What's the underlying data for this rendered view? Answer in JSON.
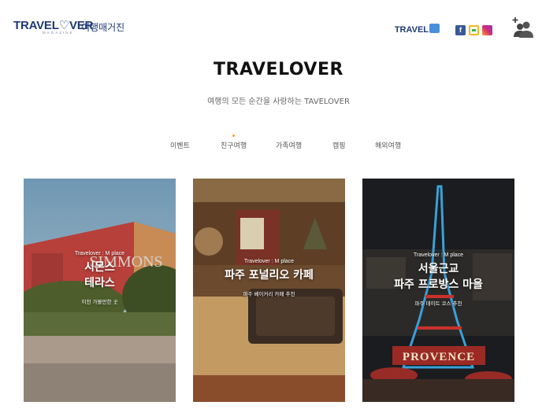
{
  "header": {
    "logo_text": "TRAVEL",
    "logo_heart": "♡",
    "logo_text_end": "VER",
    "logo_sub": "MAGAZINE",
    "logo_kr": "여행매거진",
    "travel_badge": "TRAVEL",
    "icons": [
      "facebook-icon",
      "line-icon",
      "instagram-icon",
      "add-user-icon"
    ],
    "social": {
      "fb": "f"
    }
  },
  "site": {
    "title": "TRAVELOVER",
    "subtitle": "여행의 모든 순간을 사랑하는 TAVELOVER"
  },
  "nav": {
    "items": [
      "이벤트",
      "친구여행",
      "가족여행",
      "캠핑",
      "해외여행"
    ]
  },
  "cards": [
    {
      "tag": "Travelover : M place",
      "title_line1": "시몬스",
      "title_line2": "테라스",
      "desc": "이천 가볼만한 곳",
      "building_sign": "SIMMONS"
    },
    {
      "tag": "Travelover : M place",
      "title_line1": "파주 포널리오 카페",
      "title_line2": "",
      "desc": "파주 베이커리 카페 추천"
    },
    {
      "tag": "Travelover : M place",
      "title_line1": "서울근교",
      "title_line2": "파주 프로방스 마을",
      "desc": "파주 데이트 코스 추천",
      "sign": "PROVENCE"
    }
  ],
  "colors": {
    "brand": "#1e3a73",
    "accent_dot": "#f2a12a"
  }
}
